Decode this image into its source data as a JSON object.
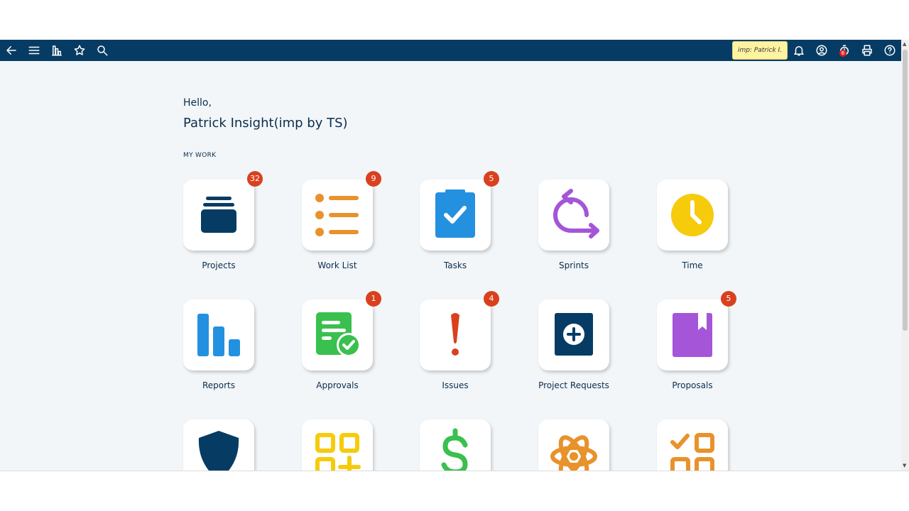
{
  "topbar": {
    "impersonation_label": "imp: Patrick I.",
    "notification_count": "6",
    "icons": [
      "back-arrow-icon",
      "menu-icon",
      "reports-icon",
      "star-icon",
      "search-icon",
      "bell-icon",
      "user-circle-icon",
      "timer-icon",
      "print-icon",
      "help-icon"
    ]
  },
  "greeting": {
    "hello": "Hello,",
    "name": "Patrick Insight(imp by TS)"
  },
  "section_title": "MY WORK",
  "tiles": [
    {
      "label": "Projects",
      "badge": "32",
      "icon": "projects-icon"
    },
    {
      "label": "Work List",
      "badge": "9",
      "icon": "work-list-icon"
    },
    {
      "label": "Tasks",
      "badge": "5",
      "icon": "tasks-icon"
    },
    {
      "label": "Sprints",
      "badge": "",
      "icon": "sprints-icon"
    },
    {
      "label": "Time",
      "badge": "",
      "icon": "time-icon"
    },
    {
      "label": "Reports",
      "badge": "",
      "icon": "reports-chart-icon"
    },
    {
      "label": "Approvals",
      "badge": "1",
      "icon": "approvals-icon"
    },
    {
      "label": "Issues",
      "badge": "4",
      "icon": "issues-icon"
    },
    {
      "label": "Project Requests",
      "badge": "",
      "icon": "project-requests-icon"
    },
    {
      "label": "Proposals",
      "badge": "5",
      "icon": "proposals-icon"
    },
    {
      "label": "",
      "badge": "",
      "icon": "shield-icon"
    },
    {
      "label": "",
      "badge": "",
      "icon": "apps-grid-icon"
    },
    {
      "label": "",
      "badge": "",
      "icon": "dollar-icon"
    },
    {
      "label": "",
      "badge": "",
      "icon": "atom-icon"
    },
    {
      "label": "",
      "badge": "",
      "icon": "checklist-grid-icon"
    }
  ],
  "colors": {
    "topbar": "#063c64",
    "badge": "#d9411e",
    "navy": "#063c64",
    "orange": "#e8922c",
    "blue": "#2391e0",
    "purple": "#a455d8",
    "yellow": "#f5cb0c",
    "green": "#39c04e",
    "red": "#d9411e"
  }
}
